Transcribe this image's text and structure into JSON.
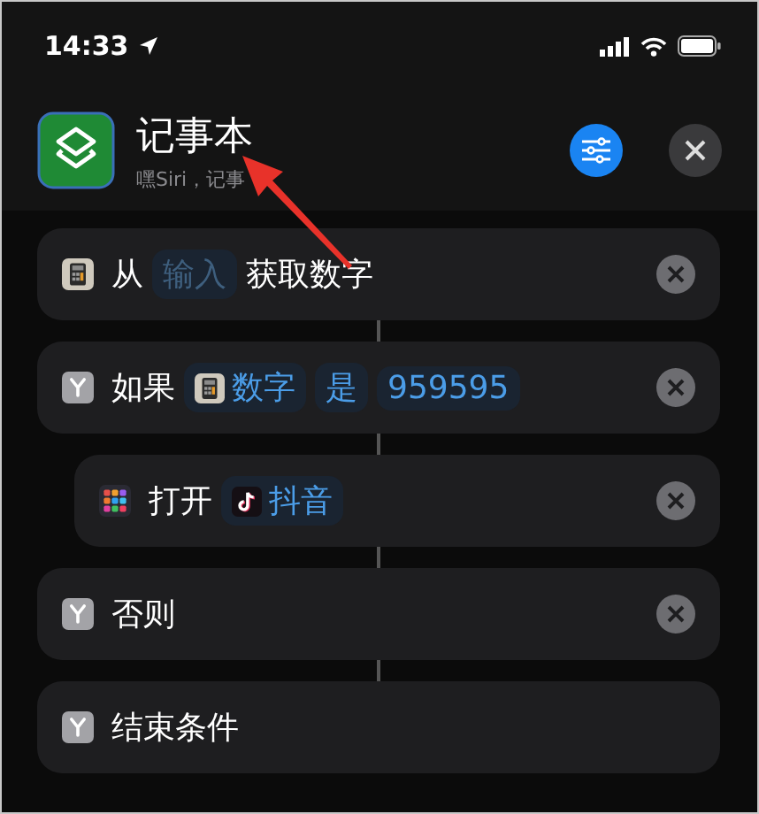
{
  "status_bar": {
    "time": "14:33"
  },
  "shortcut": {
    "title": "记事本",
    "subtitle": "嘿Siri，记事"
  },
  "actions": [
    {
      "kind": "get_number",
      "indented": false,
      "removable": true,
      "tokens": [
        {
          "kind": "text",
          "text": "从"
        },
        {
          "kind": "placeholder",
          "text": "输入"
        },
        {
          "kind": "text",
          "text": "获取数字"
        }
      ]
    },
    {
      "kind": "if",
      "indented": false,
      "removable": true,
      "tokens": [
        {
          "kind": "text",
          "text": "如果"
        },
        {
          "kind": "number_variable",
          "text": "数字"
        },
        {
          "kind": "variable",
          "text": "是"
        },
        {
          "kind": "variable",
          "text": "959595"
        }
      ]
    },
    {
      "kind": "open_app",
      "indented": true,
      "removable": true,
      "tokens": [
        {
          "kind": "text",
          "text": "打开"
        },
        {
          "kind": "app",
          "text": "抖音"
        }
      ]
    },
    {
      "kind": "otherwise",
      "indented": false,
      "removable": true,
      "tokens": [
        {
          "kind": "text",
          "text": "否则"
        }
      ]
    },
    {
      "kind": "end_if",
      "indented": false,
      "removable": false,
      "tokens": [
        {
          "kind": "text",
          "text": "结束条件"
        }
      ]
    }
  ]
}
